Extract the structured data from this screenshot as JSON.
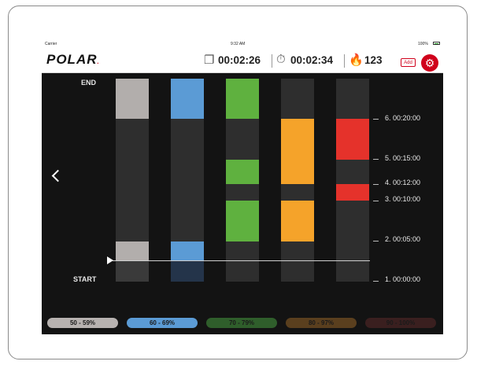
{
  "status_bar": {
    "carrier": "Carrier",
    "time": "9:32 AM",
    "battery": "100%"
  },
  "app_bar": {
    "logo": "POLAR",
    "total_time": "00:02:26",
    "phase_time": "00:02:34",
    "calories": "123",
    "add_label": "Add",
    "icons": [
      "copy-icon",
      "stopwatch-icon",
      "flame-icon",
      "gear-icon"
    ]
  },
  "chart": {
    "end_label": "END",
    "start_label": "START",
    "phases": [
      {
        "label": "6. 00:20:00"
      },
      {
        "label": "5. 00:15:00"
      },
      {
        "label": "4. 00:12:00"
      },
      {
        "label": "3. 00:10:00"
      },
      {
        "label": "2. 00:05:00"
      },
      {
        "label": "1. 00:00:00"
      }
    ]
  },
  "zones": [
    {
      "label": "50 - 59%",
      "color": "#b7b2b0"
    },
    {
      "label": "60 - 69%",
      "color": "#5b9bd5"
    },
    {
      "label": "70 - 79%",
      "color": "#2f5e2b"
    },
    {
      "label": "80 - 97%",
      "color": "#5a3f1e"
    },
    {
      "label": "90 - 100%",
      "color": "#3a1f1f"
    }
  ]
}
